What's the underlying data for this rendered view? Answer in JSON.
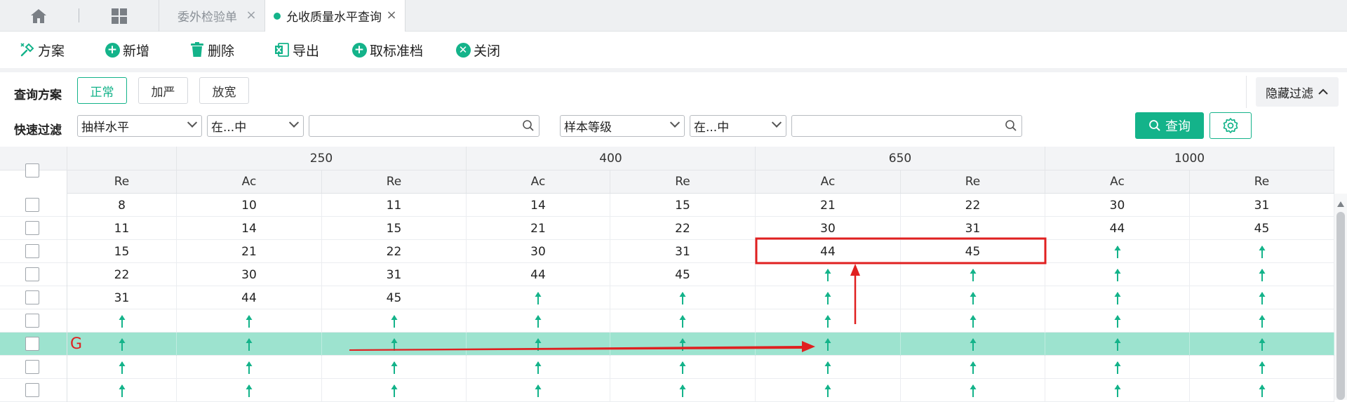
{
  "tabs": {
    "home_icon": "home-icon",
    "apps_icon": "grid-icon",
    "items": [
      {
        "label": "委外检验单",
        "close": "×",
        "active": false
      },
      {
        "label": "允收质量水平查询",
        "close": "×",
        "active": true
      }
    ]
  },
  "toolbar": {
    "plan": "方案",
    "add": "新增",
    "delete": "删除",
    "export": "导出",
    "cancel_standard": "取标准档",
    "close": "关闭"
  },
  "filter": {
    "scheme_label": "查询方案",
    "schemes": [
      "正常",
      "加严",
      "放宽"
    ],
    "active_scheme": "正常",
    "quick_label": "快速过滤",
    "field1": "抽样水平",
    "op1": "在...中",
    "value1": "",
    "field2": "样本等级",
    "op2": "在...中",
    "value2": "",
    "hide_filter": "隐藏过滤",
    "query": "查询"
  },
  "grid": {
    "group_headers": [
      "250",
      "400",
      "650",
      "1000"
    ],
    "sub_headers": [
      "Re",
      "Ac",
      "Re",
      "Ac",
      "Re",
      "Ac",
      "Re",
      "Ac",
      "Re"
    ],
    "up_symbol": "↑",
    "rows": [
      {
        "cells": [
          "8",
          "10",
          "11",
          "14",
          "15",
          "21",
          "22",
          "30",
          "31"
        ]
      },
      {
        "cells": [
          "11",
          "14",
          "15",
          "21",
          "22",
          "30",
          "31",
          "44",
          "45"
        ]
      },
      {
        "cells": [
          "15",
          "21",
          "22",
          "30",
          "31",
          "44",
          "45",
          "↑",
          "↑"
        ]
      },
      {
        "cells": [
          "22",
          "30",
          "31",
          "44",
          "45",
          "↑",
          "↑",
          "↑",
          "↑"
        ]
      },
      {
        "cells": [
          "31",
          "44",
          "45",
          "↑",
          "↑",
          "↑",
          "↑",
          "↑",
          "↑"
        ]
      },
      {
        "cells": [
          "↑",
          "↑",
          "↑",
          "↑",
          "↑",
          "↑",
          "↑",
          "↑",
          "↑"
        ]
      },
      {
        "cells": [
          "↑",
          "↑",
          "↑",
          "↑",
          "↑",
          "↑",
          "↑",
          "↑",
          "↑"
        ],
        "selected": true,
        "annotation": "G"
      },
      {
        "cells": [
          "↑",
          "↑",
          "↑",
          "↑",
          "↑",
          "↑",
          "↑",
          "↑",
          "↑"
        ]
      },
      {
        "cells": [
          "↑",
          "↑",
          "↑",
          "↑",
          "↑",
          "↑",
          "↑",
          "↑",
          "↑"
        ]
      }
    ]
  },
  "colors": {
    "accent": "#14b38a",
    "selected_row": "#9de3cf",
    "annotation": "#e02020"
  }
}
